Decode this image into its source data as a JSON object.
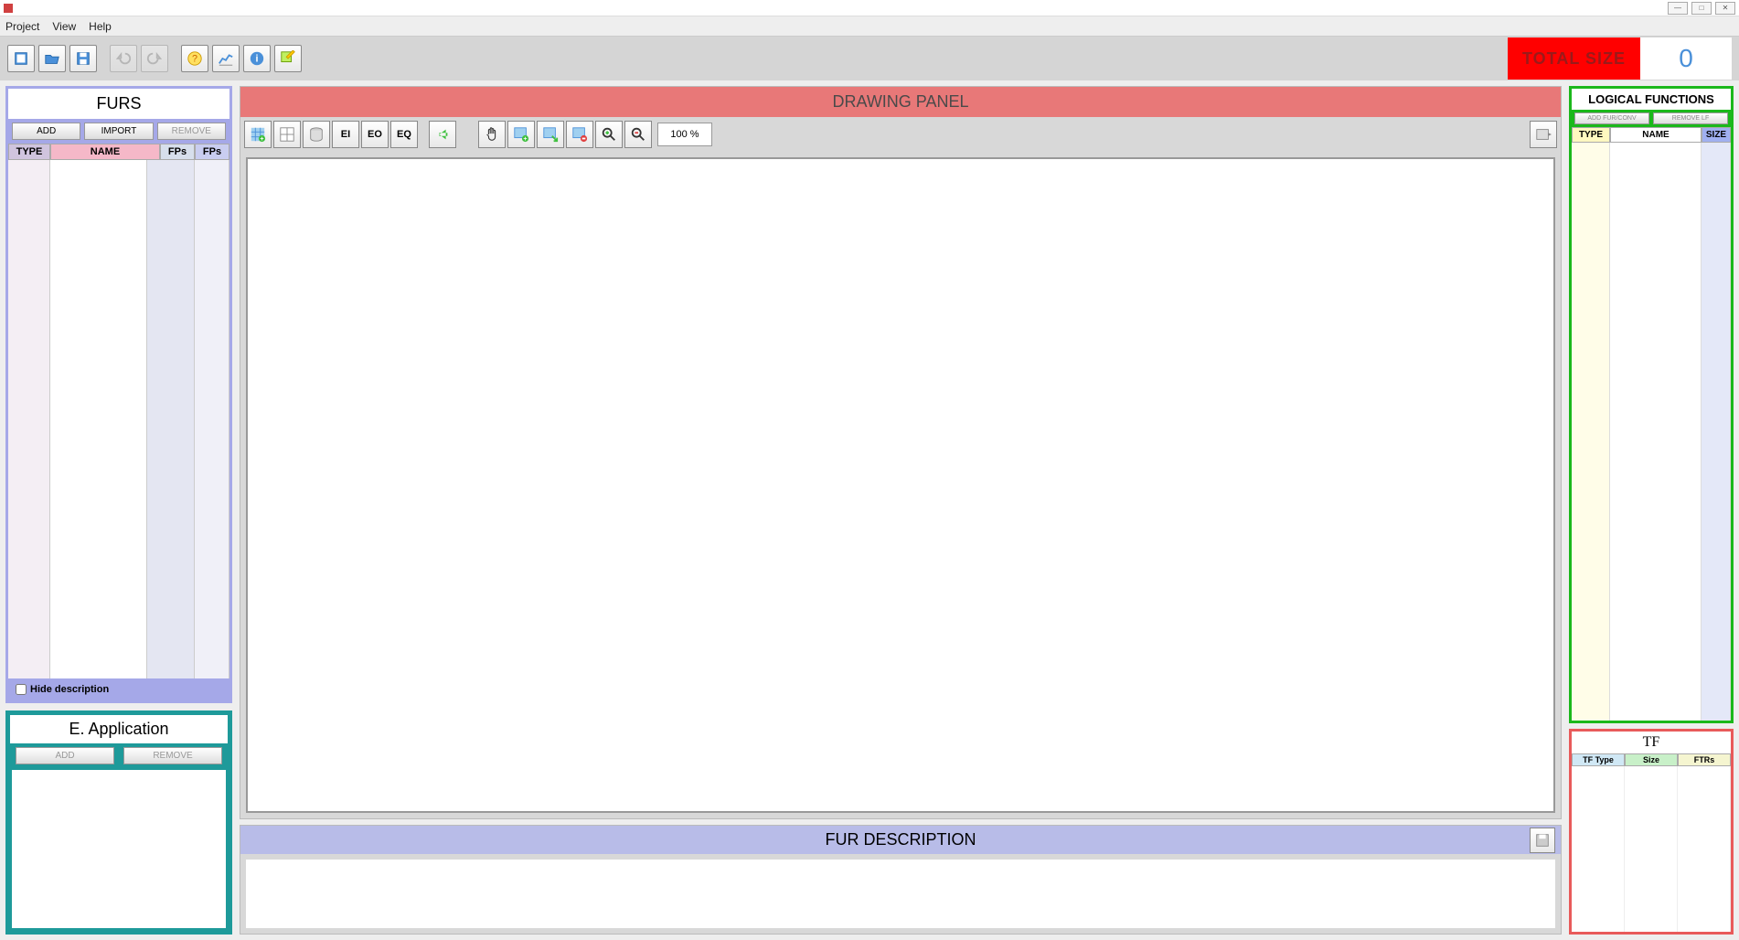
{
  "menu": {
    "project": "Project",
    "view": "View",
    "help": "Help"
  },
  "total_size": {
    "label": "TOTAL SIZE",
    "value": "0"
  },
  "furs": {
    "title": "FURS",
    "add": "ADD",
    "import": "IMPORT",
    "remove": "REMOVE",
    "cols": {
      "type": "TYPE",
      "name": "NAME",
      "fps1": "FPs",
      "fps2": "FPs"
    },
    "hide_desc": "Hide description"
  },
  "eapp": {
    "title": "E. Application",
    "add": "ADD",
    "remove": "REMOVE"
  },
  "drawing": {
    "title": "DRAWING PANEL",
    "zoom": "100 %",
    "ei": "EI",
    "eo": "EO",
    "eq": "EQ"
  },
  "fur_desc": {
    "title": "FUR DESCRIPTION"
  },
  "lf": {
    "title": "LOGICAL FUNCTIONS",
    "add": "ADD FUR/CONV",
    "remove": "REMOVE LF",
    "cols": {
      "type": "TYPE",
      "name": "NAME",
      "size": "SIZE"
    }
  },
  "tf": {
    "title": "TF",
    "cols": {
      "type": "TF Type",
      "size": "Size",
      "ftrs": "FTRs"
    }
  }
}
